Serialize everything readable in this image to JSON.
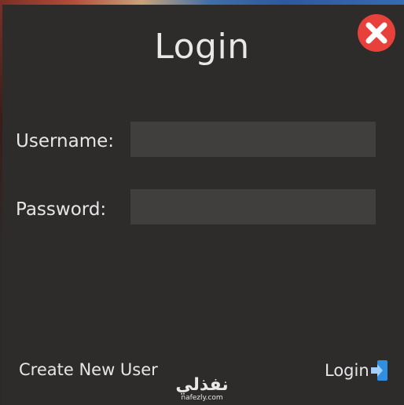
{
  "window": {
    "title": "Login"
  },
  "form": {
    "username_label": "Username:",
    "username_value": "",
    "password_label": "Password:",
    "password_value": ""
  },
  "footer": {
    "create_user_label": "Create New User",
    "login_label": "Login"
  },
  "watermark": {
    "arabic": "نفذلي",
    "site": "nafezly.com"
  },
  "icons": {
    "close": "close-icon",
    "login": "login-door-icon"
  },
  "colors": {
    "background": "#2d2c2b",
    "field": "#403f3e",
    "text": "#e6e6e6",
    "close_red": "#e8413b",
    "login_icon_blue": "#2f8fe0"
  }
}
